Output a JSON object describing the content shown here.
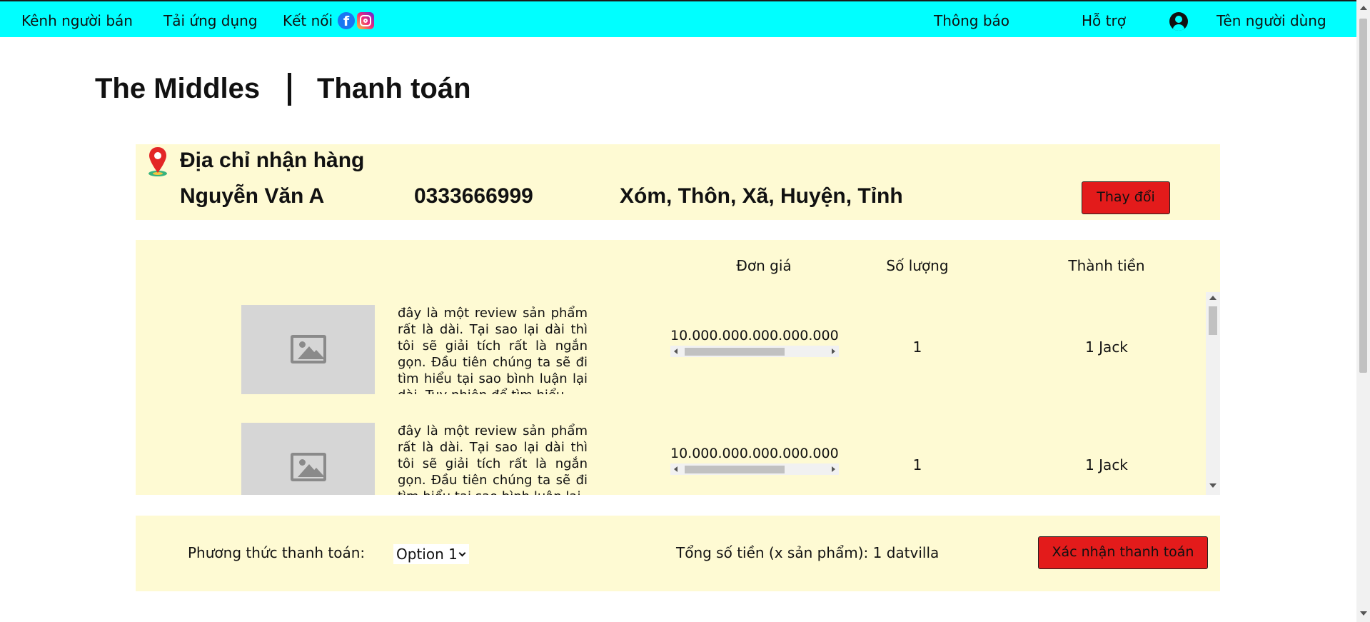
{
  "topbar": {
    "seller_channel": "Kênh người bán",
    "download_app": "Tải ứng dụng",
    "connect": "Kết nối",
    "notifications": "Thông báo",
    "support": "Hỗ trợ",
    "username": "Tên người dùng",
    "colors": {
      "background": "#00ffff",
      "facebook": "#1877f2"
    }
  },
  "header": {
    "brand": "The Middles",
    "title": "Thanh toán"
  },
  "address": {
    "title": "Địa chỉ nhận hàng",
    "name": "Nguyễn Văn A",
    "phone": "0333666999",
    "location": "Xóm, Thôn, Xã, Huyện, Tỉnh",
    "change_label": "Thay đổi"
  },
  "products": {
    "headers": {
      "unit_price": "Đơn giá",
      "quantity": "Số lượng",
      "total": "Thành tiền"
    },
    "items": [
      {
        "review": "đây là một review sản phẩm rất là dài. Tại sao lại dài thì tôi sẽ giải tích rất là ngắn gọn. Đầu tiên chúng ta sẽ đi tìm hiểu tại sao bình luận lại dài. Tuy nhiên để tìm hiểu",
        "price": "10.000.000.000.000.000.",
        "quantity": "1",
        "total": "1 Jack"
      },
      {
        "review": "đây là một review sản phẩm rất là dài. Tại sao lại dài thì tôi sẽ giải tích rất là ngắn gọn. Đầu tiên chúng ta sẽ đi tìm hiểu tại sao bình luận lại",
        "price": "10.000.000.000.000.000.",
        "quantity": "1",
        "total": "1 Jack"
      }
    ]
  },
  "checkout": {
    "payment_label": "Phương thức thanh toán:",
    "payment_selected": "Option 1",
    "summary": "Tổng số tiền (x sản phẩm): 1 datvilla",
    "confirm_label": "Xác nhận thanh toán"
  },
  "colors": {
    "panel_bg": "#fefad3",
    "button_red": "#e31b1b"
  },
  "icons": [
    "facebook-icon",
    "instagram-icon",
    "user-account-icon",
    "location-pin-icon",
    "image-placeholder-icon",
    "chevron-down-icon"
  ]
}
